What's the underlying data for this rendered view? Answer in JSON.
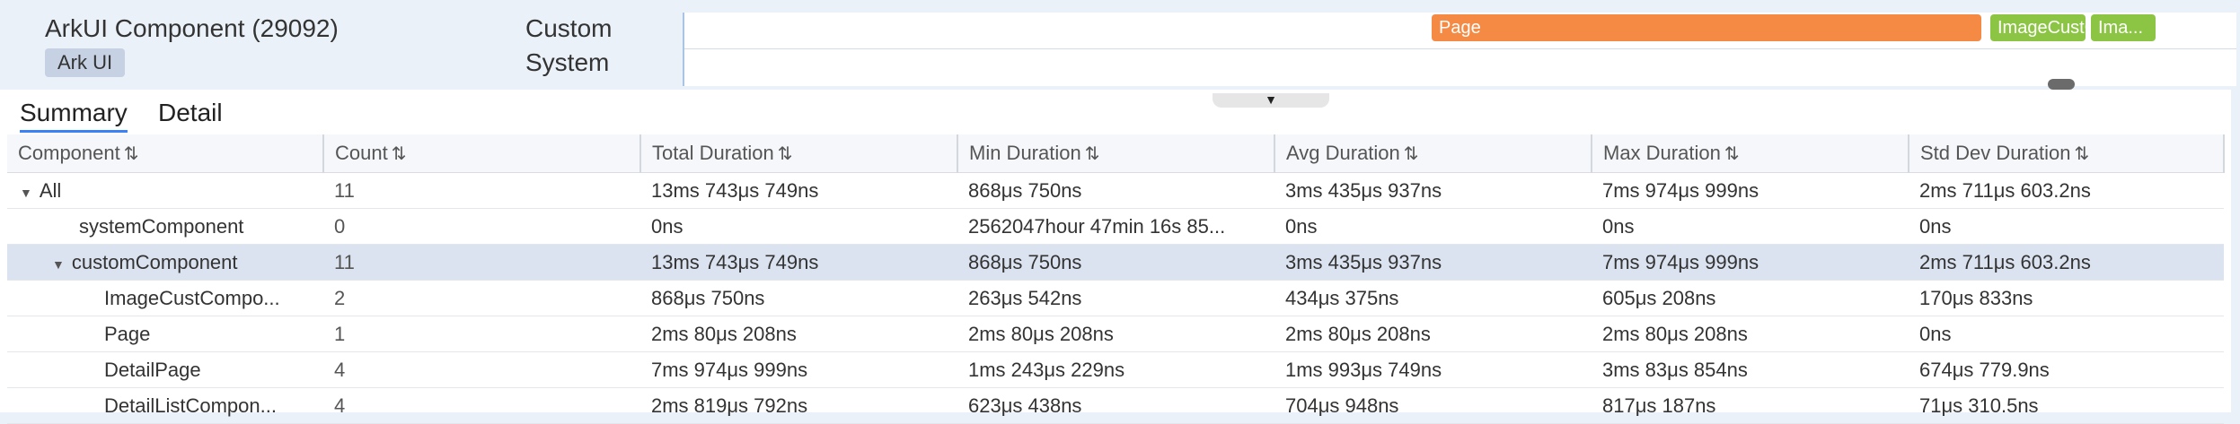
{
  "track": {
    "title": "ArkUI Component (29092)",
    "tag": "Ark UI",
    "row_labels": [
      "Custom",
      "System"
    ],
    "slices": [
      {
        "label": "Page",
        "color": "#f48a43"
      },
      {
        "label": "ImageCustC...",
        "color": "#8cc544"
      },
      {
        "label": "Ima...",
        "color": "#8cc544"
      }
    ]
  },
  "tabs": [
    "Summary",
    "Detail"
  ],
  "active_tab": "Summary",
  "table": {
    "columns": [
      "Component",
      "Count",
      "Total Duration",
      "Min Duration",
      "Avg Duration",
      "Max Duration",
      "Std Dev Duration"
    ],
    "rows": [
      {
        "name": "All",
        "expanded": true,
        "count": "11",
        "total": "13ms 743μs 749ns",
        "min": "868μs 750ns",
        "avg": "3ms 435μs 937ns",
        "max": "7ms 974μs 999ns",
        "std": "2ms 711μs 603.2ns"
      },
      {
        "name": "systemComponent",
        "count": "0",
        "total": "0ns",
        "min": "2562047hour 47min 16s 85...",
        "avg": "0ns",
        "max": "0ns",
        "std": "0ns"
      },
      {
        "name": "customComponent",
        "expanded": true,
        "selected": true,
        "count": "11",
        "total": "13ms 743μs 749ns",
        "min": "868μs 750ns",
        "avg": "3ms 435μs 937ns",
        "max": "7ms 974μs 999ns",
        "std": "2ms 711μs 603.2ns"
      },
      {
        "name": "ImageCustCompo...",
        "count": "2",
        "total": "868μs 750ns",
        "min": "263μs 542ns",
        "avg": "434μs 375ns",
        "max": "605μs 208ns",
        "std": "170μs 833ns"
      },
      {
        "name": "Page",
        "count": "1",
        "total": "2ms 80μs 208ns",
        "min": "2ms 80μs 208ns",
        "avg": "2ms 80μs 208ns",
        "max": "2ms 80μs 208ns",
        "std": "0ns"
      },
      {
        "name": "DetailPage",
        "count": "4",
        "total": "7ms 974μs 999ns",
        "min": "1ms 243μs 229ns",
        "avg": "1ms 993μs 749ns",
        "max": "3ms 83μs 854ns",
        "std": "674μs 779.9ns"
      },
      {
        "name": "DetailListCompon...",
        "count": "4",
        "total": "2ms 819μs 792ns",
        "min": "623μs 438ns",
        "avg": "704μs 948ns",
        "max": "817μs 187ns",
        "std": "71μs 310.5ns"
      }
    ]
  }
}
